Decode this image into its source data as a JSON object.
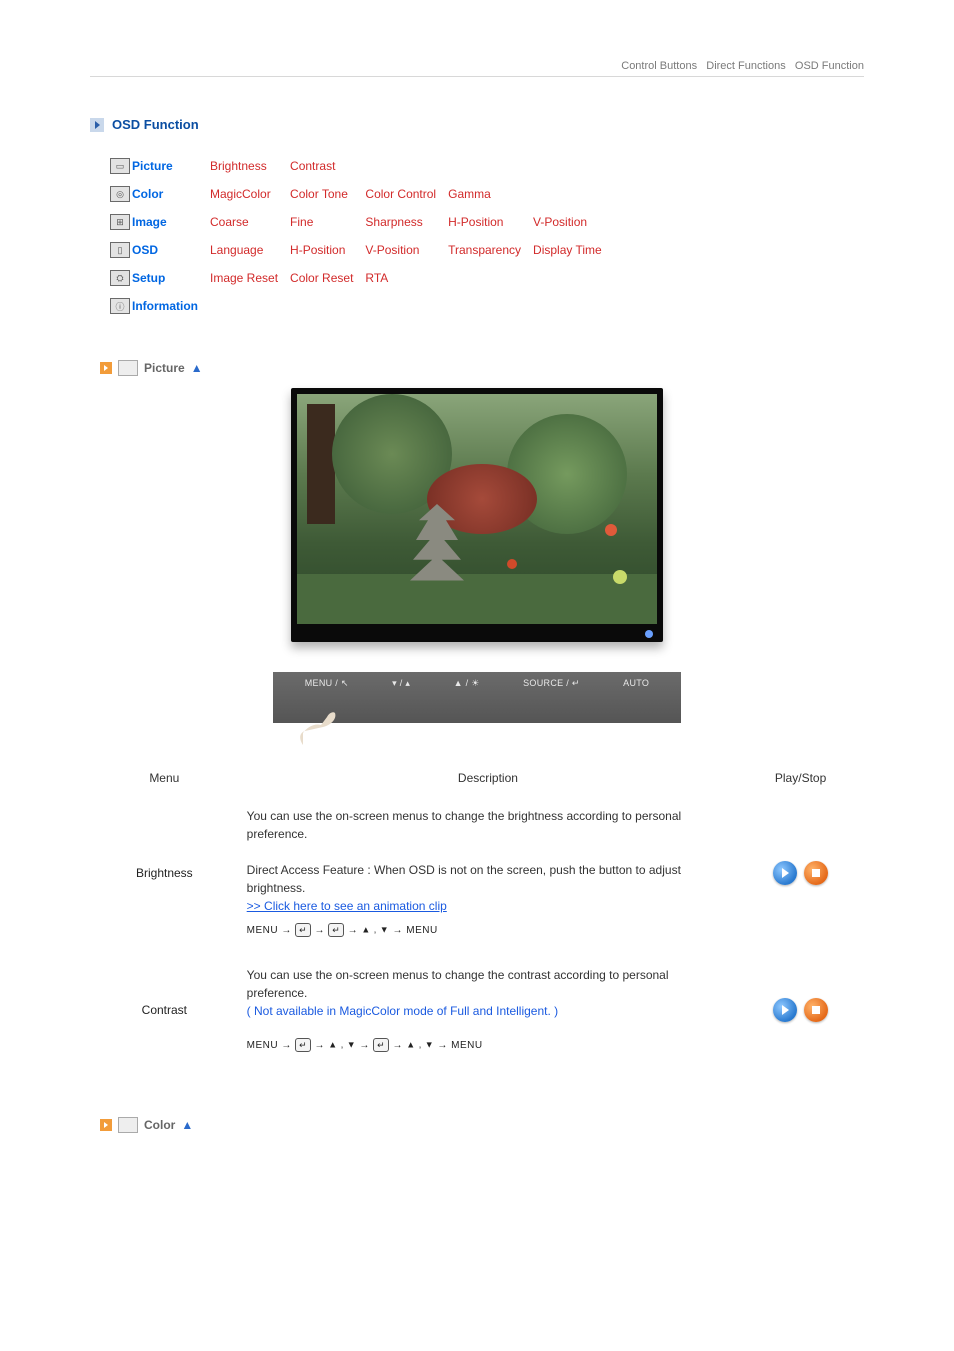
{
  "top_nav": {
    "control_buttons": "Control Buttons",
    "direct_functions": "Direct Functions",
    "osd_function": "OSD Function"
  },
  "section_title": "OSD Function",
  "categories": [
    {
      "label": "Picture",
      "links": [
        "Brightness",
        "Contrast"
      ]
    },
    {
      "label": "Color",
      "links": [
        "MagicColor",
        "Color Tone",
        "Color Control",
        "Gamma"
      ]
    },
    {
      "label": "Image",
      "links": [
        "Coarse",
        "Fine",
        "Sharpness",
        "H-Position",
        "V-Position"
      ]
    },
    {
      "label": "OSD",
      "links": [
        "Language",
        "H-Position",
        "V-Position",
        "Transparency",
        "Display Time"
      ]
    },
    {
      "label": "Setup",
      "links": [
        "Image Reset",
        "Color Reset",
        "RTA"
      ]
    },
    {
      "label": "Information",
      "links": []
    }
  ],
  "sub_sections": {
    "picture": "Picture",
    "color": "Color"
  },
  "button_strip": {
    "b1": "MENU / ↖",
    "b2": "▾ / ▴",
    "b3": "▲ / ☀",
    "b4": "SOURCE / ↵",
    "b5": "AUTO"
  },
  "table_headers": {
    "menu": "Menu",
    "description": "Description",
    "play_stop": "Play/Stop"
  },
  "rows": {
    "brightness": {
      "menu": "Brightness",
      "desc1": "You can use the on-screen menus to change the brightness according to personal preference.",
      "desc2": "Direct Access Feature : When OSD is not on the screen, push the button to adjust brightness.",
      "anim_link": ">> Click here to see an animation clip",
      "seq_prefix": "MENU → ",
      "seq_mid1": " → ",
      "seq_mid2": " → ",
      "seq_arrows": "▲ , ▼",
      "seq_suffix": " → MENU"
    },
    "contrast": {
      "menu": "Contrast",
      "desc1": "You can use the on-screen menus to change the contrast according to personal preference.",
      "note": "( Not available in MagicColor mode of Full and Intelligent. )",
      "seq_prefix": "MENU → ",
      "seq_mid1": " → ",
      "seq_arrows1": "▲ , ▼",
      "seq_mid2": " → ",
      "seq_mid3": " → ",
      "seq_arrows2": "▲ , ▼",
      "seq_suffix": " → MENU"
    }
  }
}
